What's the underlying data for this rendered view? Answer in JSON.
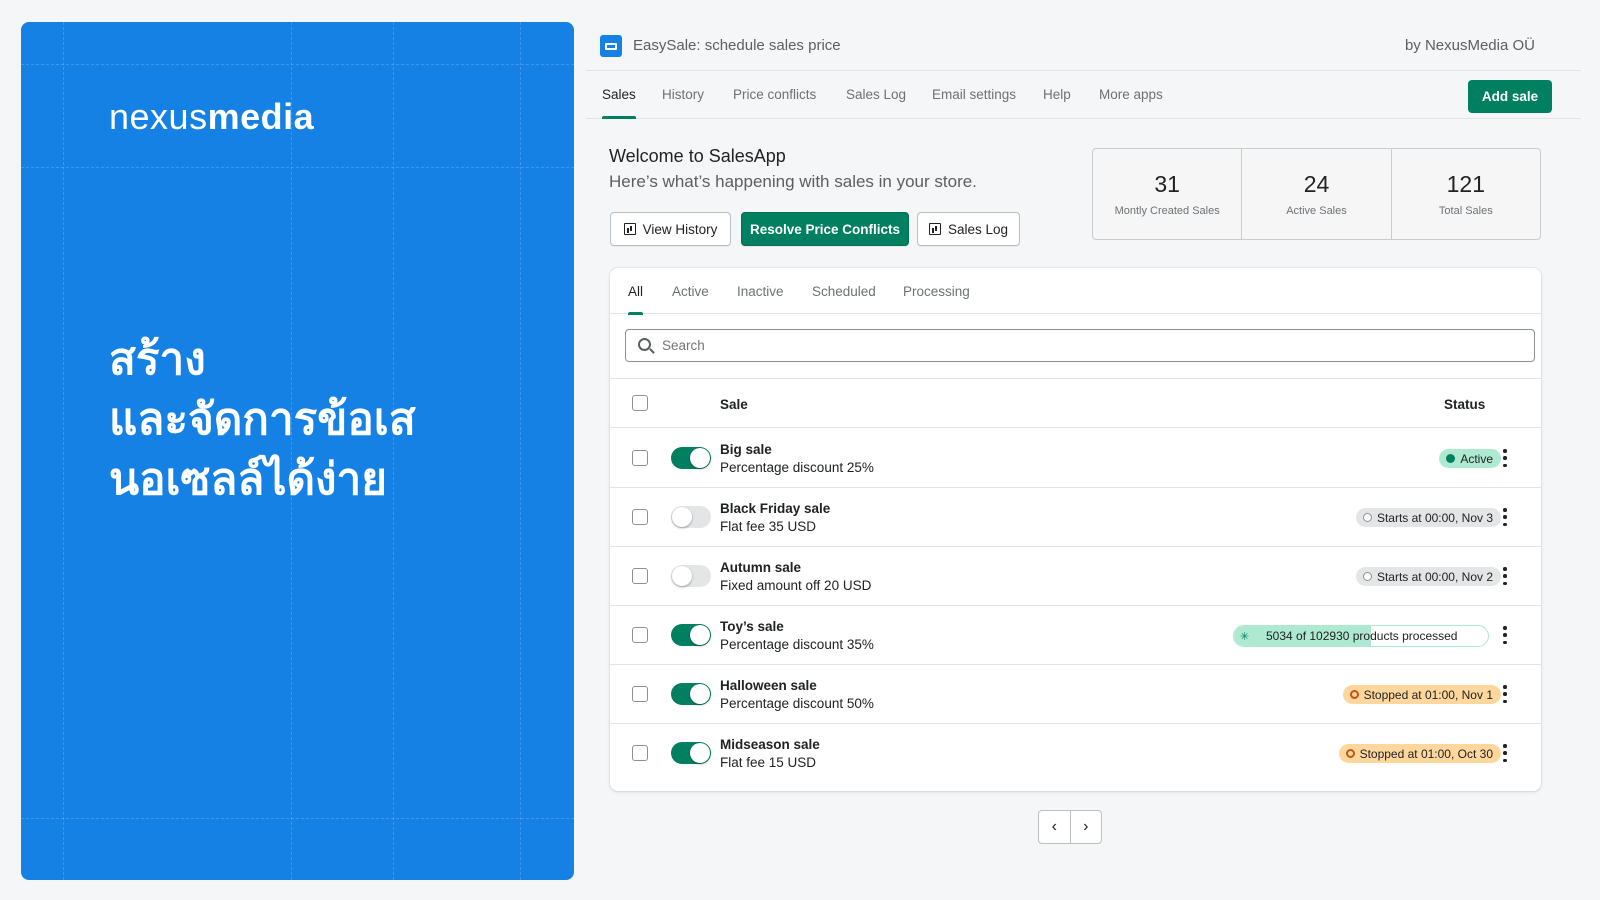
{
  "promo": {
    "logo_light": "nexus",
    "logo_bold": "media",
    "headline": [
      "สร้าง",
      "และจัดการข้อเส",
      "นอเซลล์ได้ง่าย"
    ]
  },
  "topbar": {
    "app_title": "EasySale: schedule sales price",
    "vendor": "by NexusMedia OÜ"
  },
  "nav": {
    "tabs": [
      "Sales",
      "History",
      "Price conflicts",
      "Sales Log",
      "Email settings",
      "Help",
      "More apps"
    ],
    "active_tab": "Sales",
    "add_sale_label": "Add sale"
  },
  "welcome": {
    "title": "Welcome to SalesApp",
    "subtitle": "Here’s what’s happening with sales in your store.",
    "buttons": {
      "view_history": "View History",
      "resolve_conflicts": "Resolve Price Conflicts",
      "sales_log": "Sales Log"
    }
  },
  "stats": [
    {
      "value": "31",
      "label": "Montly Created Sales"
    },
    {
      "value": "24",
      "label": "Active Sales"
    },
    {
      "value": "121",
      "label": "Total Sales"
    }
  ],
  "card": {
    "tabs": [
      "All",
      "Active",
      "Inactive",
      "Scheduled",
      "Processing"
    ],
    "active_tab": "All",
    "search_placeholder": "Search",
    "columns": {
      "sale": "Sale",
      "status": "Status"
    },
    "rows": [
      {
        "name": "Big sale",
        "desc": "Percentage discount 25%",
        "enabled": true,
        "status_type": "active",
        "status": "Active"
      },
      {
        "name": "Black Friday sale",
        "desc": "Flat fee 35 USD",
        "enabled": false,
        "status_type": "scheduled",
        "status": "Starts at 00:00, Nov 3"
      },
      {
        "name": "Autumn sale",
        "desc": "Fixed amount off 20 USD",
        "enabled": false,
        "status_type": "scheduled",
        "status": "Starts at 00:00, Nov 2"
      },
      {
        "name": "Toy’s sale",
        "desc": "Percentage discount 35%",
        "enabled": true,
        "status_type": "processing",
        "status": "5034 of 102930 products processed",
        "progress_fraction": 0.54
      },
      {
        "name": "Halloween sale",
        "desc": "Percentage discount 50%",
        "enabled": true,
        "status_type": "stopped",
        "status": "Stopped at 01:00, Nov 1"
      },
      {
        "name": "Midseason sale",
        "desc": "Flat fee 15 USD",
        "enabled": true,
        "status_type": "stopped",
        "status": "Stopped at 01:00, Oct 30"
      }
    ]
  },
  "pager": {
    "prev": "‹",
    "next": "›"
  },
  "colors": {
    "brand_blue": "#1681e4",
    "primary_green": "#008060",
    "active_badge": "#aee9d1",
    "stopped_badge": "#ffd79d"
  },
  "icons": {
    "app": "ticket-icon",
    "search": "search-icon",
    "chart": "bar-chart-icon",
    "menu": "kebab-menu-icon"
  }
}
